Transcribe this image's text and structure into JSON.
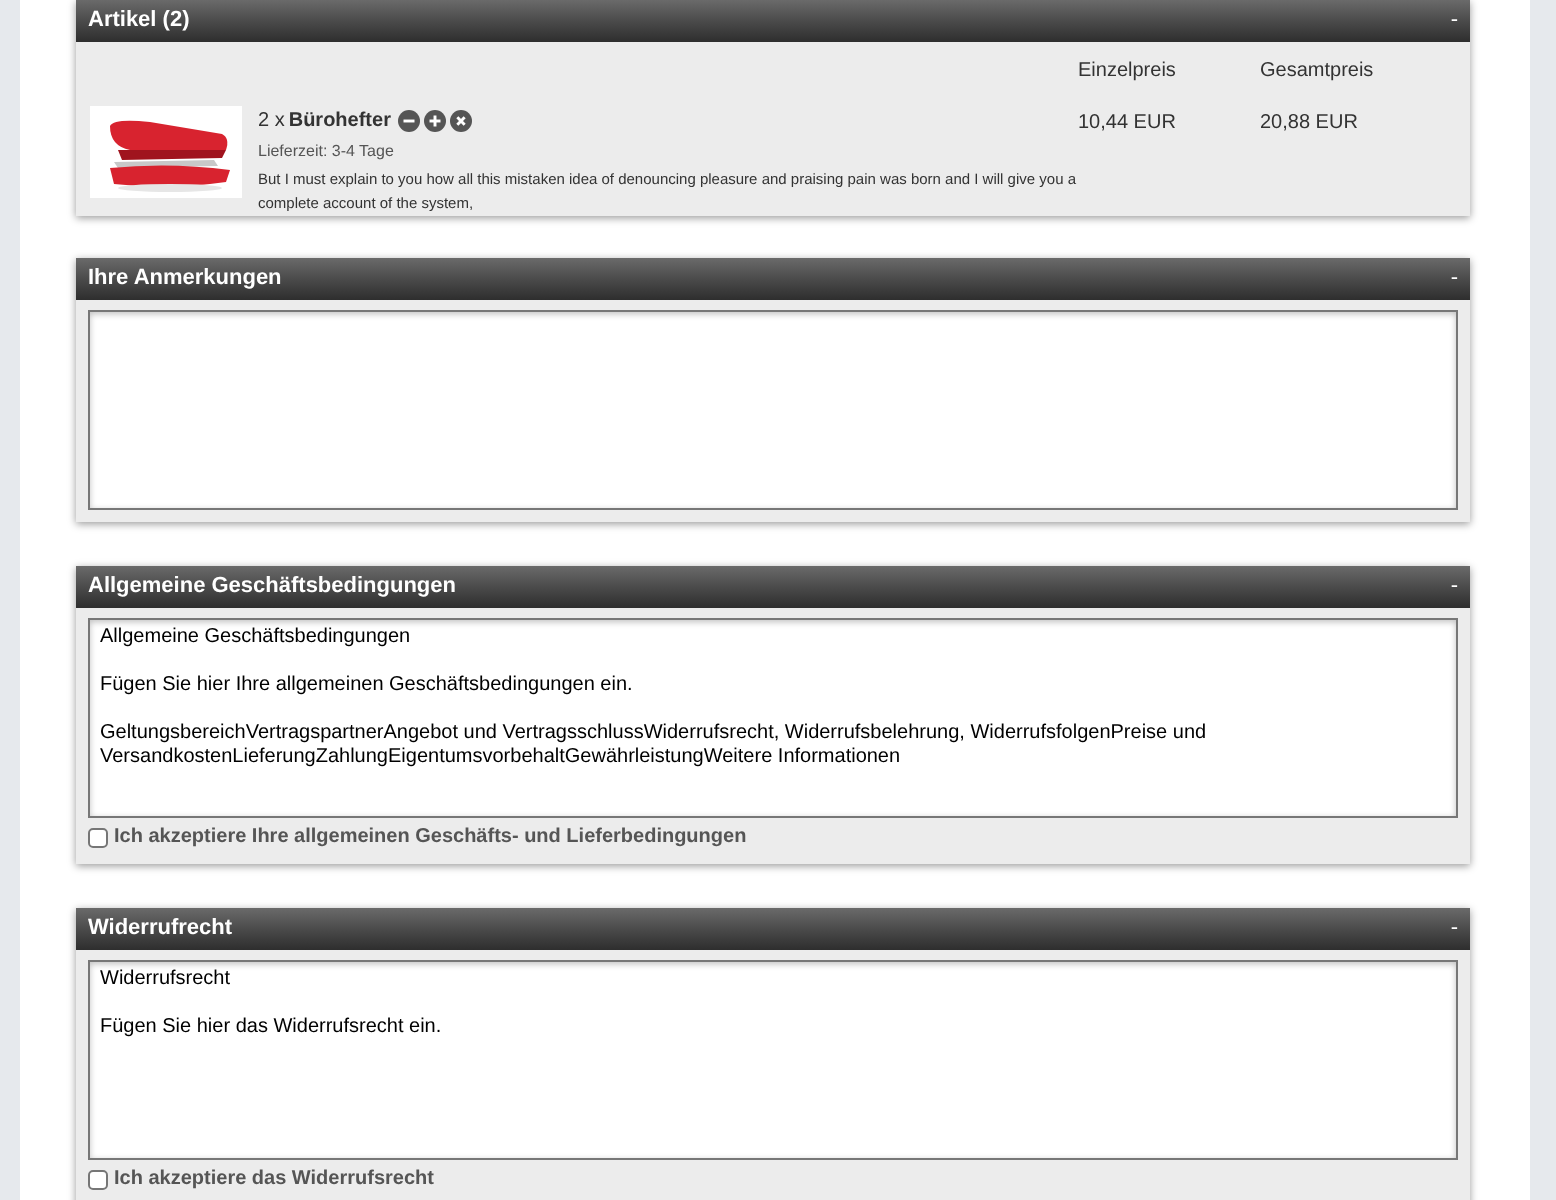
{
  "cart": {
    "title": "Artikel (2)",
    "collapse": "-",
    "columns": [
      "Einzelpreis",
      "Gesamtpreis"
    ],
    "items": [
      {
        "kind": "picture",
        "quantity": "2 x",
        "name": "Bürohefter",
        "delivery": "Lieferzeit: 3-4 Tage",
        "description": "But I must explain to you how all this mistaken idea of denouncing pleasure and praising pain was born and I will give you a complete account of the system,",
        "unit_price": "10,44 EUR",
        "total_price": "20,88 EUR"
      }
    ]
  },
  "sections": [
    {
      "title": "Ihre Anmerkungen",
      "collapse": "-"
    },
    {
      "title": "Allgemeine Geschäftsbedingungen",
      "collapse": "-",
      "text": "Allgemeine Geschäftsbedingungen\n\nFügen Sie hier Ihre allgemeinen Geschäftsbedingungen ein.\n\nGeltungsbereichVertragspartnerAngebot und VertragsschlussWiderrufsrecht, Widerrufsbelehrung, WiderrufsfolgenPreise und VersandkostenLieferungZahlungEigentumsvorbehaltGewährleistungWeitere Informationen",
      "accept": {
        "label": "Ich akzeptiere Ihre allgemeinen Geschäfts- und Lieferbedingungen",
        "checked": false
      }
    },
    {
      "title": "Widerrufrecht",
      "collapse": "-",
      "text": "Widerrufsrecht\n\nFügen Sie hier das Widerrufsrecht ein.",
      "accept": {
        "label": "Ich akzeptiere das Widerrufsrecht",
        "checked": false
      }
    }
  ]
}
